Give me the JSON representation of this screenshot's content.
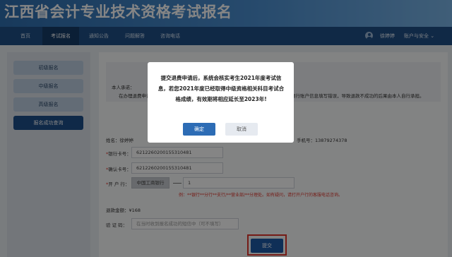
{
  "header": {
    "title": "江西省会计专业技术资格考试报名"
  },
  "nav": {
    "items": [
      "首页",
      "考试报名",
      "通知公告",
      "问题解答",
      "咨询电话"
    ],
    "active": "考试报名",
    "user_name": "徐婷婷",
    "account_menu": "账户与安全 ⌄"
  },
  "sidebar": {
    "items": [
      "初级报名",
      "中级报名",
      "高级报名",
      "报名成功查询"
    ],
    "active": "报名成功查询"
  },
  "notice": {
    "line1": "本人承诺：",
    "line2": "在办理退费申请",
    "line2_tail": "银行账户信息填写错误，导致退款不成功的后果由本人自行承担。"
  },
  "form": {
    "name_label": "姓名：",
    "name_value": "徐婷婷",
    "phone_label": "手机号：",
    "phone_value": "13879274378",
    "card_label": "银行卡号：",
    "card_value": "6212260200155310481",
    "confirm_label": "确认卡号：",
    "confirm_value": "6212260200155310481",
    "bank_label": "开 户 行：",
    "bank_select": "中国工商银行",
    "bank_branch": "1",
    "bank_hint": "例：**银行**分行**支行/**营业部/**分理处。如有疑问，请打开户行的客服电话咨询。",
    "refund_label": "退款金额：",
    "refund_value": "¥168",
    "code_label": "验 证 码：",
    "code_placeholder": "在当时收到报名成功的短信中（可不填写）",
    "submit": "提交"
  },
  "modal": {
    "message": "提交退费申请后，系统会核实考生2021年度考试信息，若您2021年度已经取得中级资格相关科目考试合格成绩，有效期将相应延长至2023年!",
    "confirm": "确定",
    "cancel": "取消"
  },
  "colors": {
    "nav_bg": "#1f4f86",
    "accent": "#1e5aa8",
    "required": "#e0392e",
    "highlight_frame": "#e0352b"
  }
}
